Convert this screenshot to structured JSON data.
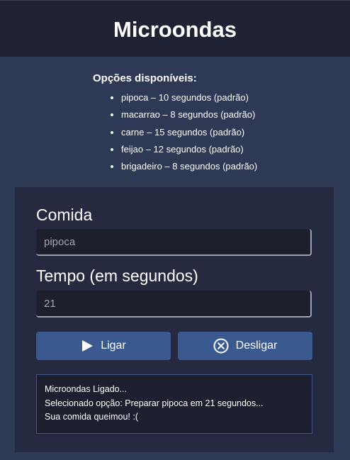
{
  "header": {
    "title": "Microondas"
  },
  "options": {
    "title": "Opções disponíveis:",
    "items": [
      "pipoca – 10 segundos (padrão)",
      "macarrao – 8 segundos (padrão)",
      "carne – 15 segundos (padrão)",
      "feijao – 12 segundos (padrão)",
      "brigadeiro – 8 segundos (padrão)"
    ]
  },
  "form": {
    "food_label": "Comida",
    "food_value": "pipoca",
    "time_label": "Tempo (em segundos)",
    "time_value": "21"
  },
  "buttons": {
    "start_label": "Ligar",
    "start_icon": "play-icon",
    "stop_label": "Desligar",
    "stop_icon": "close-circle-icon"
  },
  "log": {
    "lines": [
      "Microondas Ligado...",
      "Selecionado opção: Preparar pipoca em 21 segundos...",
      "Sua comida queimou! :("
    ]
  },
  "colors": {
    "background": "#2e3a55",
    "header": "#1f2233",
    "panel": "#262a40",
    "button": "#3a5a8f"
  }
}
